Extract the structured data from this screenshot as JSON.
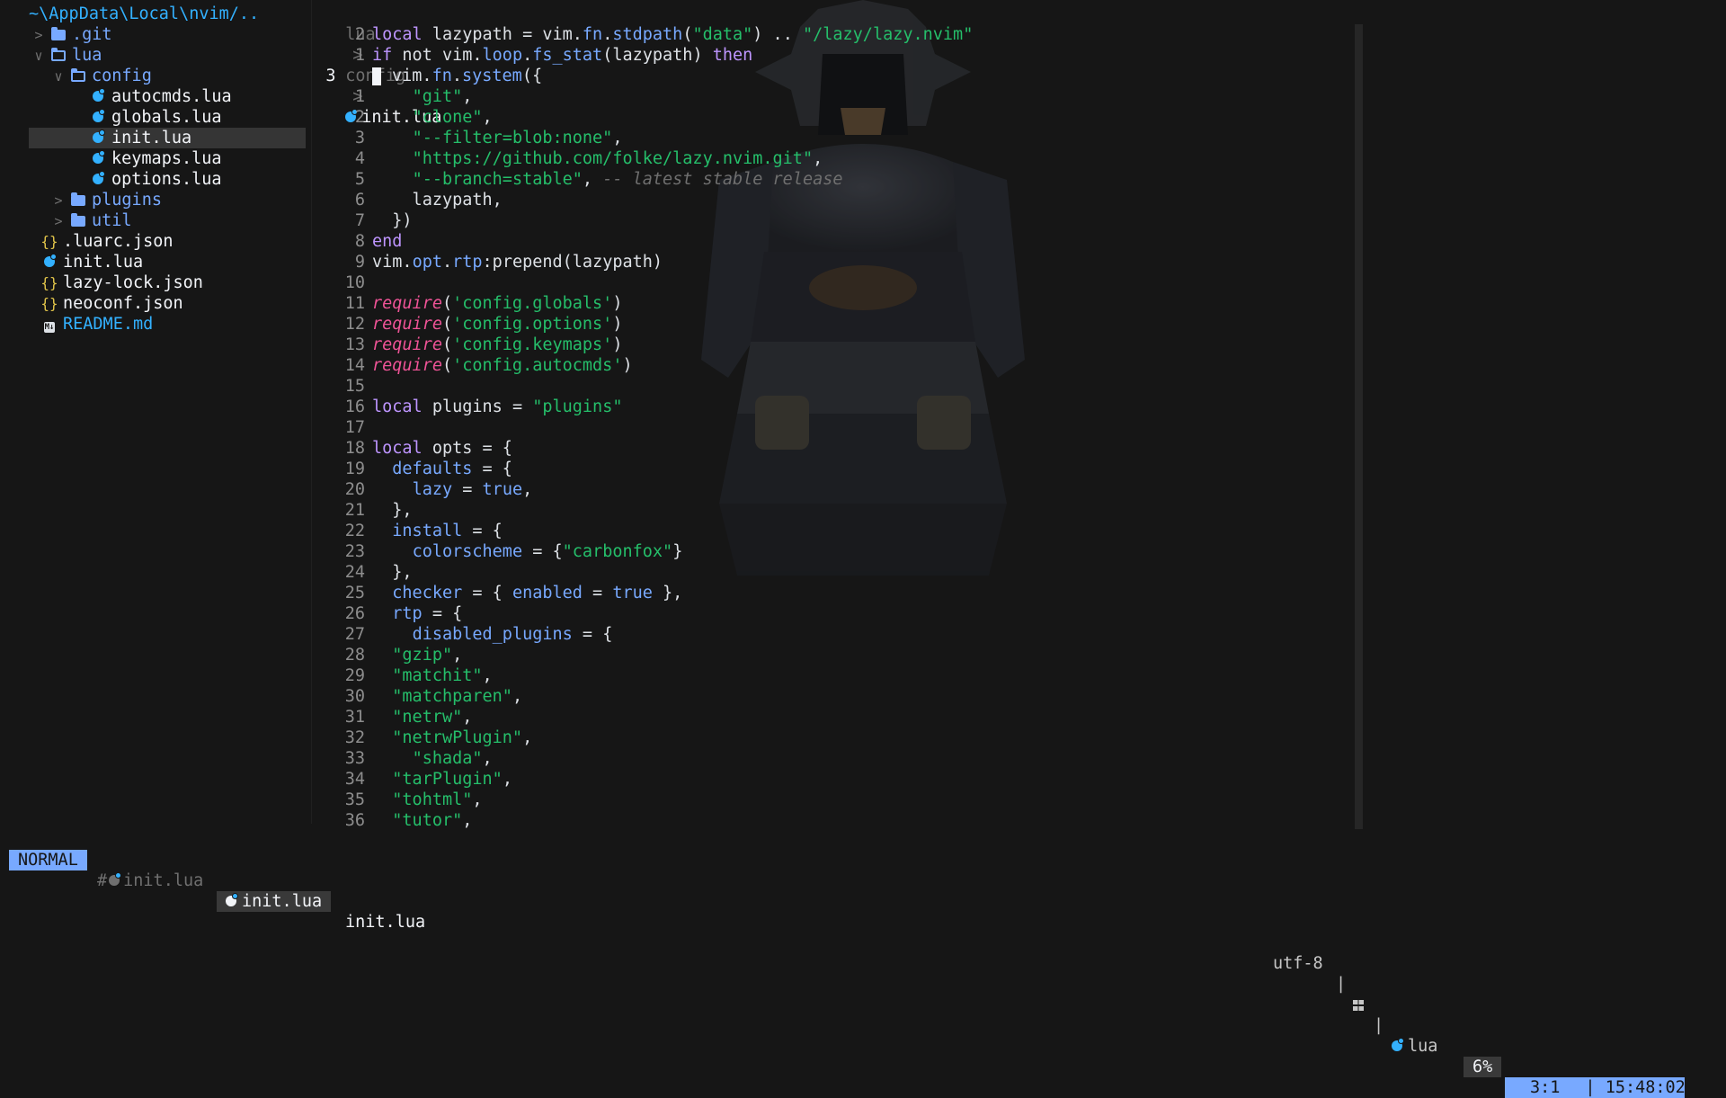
{
  "tree": {
    "root": "~\\AppData\\Local\\nvim/..",
    "items": [
      {
        "name": ".git",
        "kind": "dir",
        "depth": 0,
        "open": false,
        "icon": "folder-icon"
      },
      {
        "name": "lua",
        "kind": "dir",
        "depth": 0,
        "open": true,
        "icon": "folder-open-icon"
      },
      {
        "name": "config",
        "kind": "dir",
        "depth": 1,
        "open": true,
        "icon": "folder-open-icon"
      },
      {
        "name": "autocmds.lua",
        "kind": "lua",
        "depth": 2,
        "icon": "lua-icon"
      },
      {
        "name": "globals.lua",
        "kind": "lua",
        "depth": 2,
        "icon": "lua-icon"
      },
      {
        "name": "init.lua",
        "kind": "lua",
        "depth": 2,
        "icon": "lua-icon",
        "selected": true
      },
      {
        "name": "keymaps.lua",
        "kind": "lua",
        "depth": 2,
        "icon": "lua-icon"
      },
      {
        "name": "options.lua",
        "kind": "lua",
        "depth": 2,
        "icon": "lua-icon"
      },
      {
        "name": "plugins",
        "kind": "dir",
        "depth": 1,
        "open": false,
        "icon": "folder-icon"
      },
      {
        "name": "util",
        "kind": "dir",
        "depth": 1,
        "open": false,
        "icon": "folder-icon"
      },
      {
        "name": ".luarc.json",
        "kind": "json",
        "depth": 0,
        "icon": "json-icon"
      },
      {
        "name": "init.lua",
        "kind": "lua",
        "depth": 0,
        "icon": "lua-icon"
      },
      {
        "name": "lazy-lock.json",
        "kind": "json",
        "depth": 0,
        "icon": "json-icon"
      },
      {
        "name": "neoconf.json",
        "kind": "json",
        "depth": 0,
        "icon": "json-icon"
      },
      {
        "name": "README.md",
        "kind": "md",
        "depth": 0,
        "icon": "markdown-icon"
      }
    ]
  },
  "winbar": {
    "parts": [
      "lua",
      "config"
    ],
    "separator": ">",
    "file": "init.lua"
  },
  "code": [
    {
      "n": "2",
      "tokens": [
        [
          "kw",
          "local"
        ],
        [
          "src",
          " lazypath = vim."
        ],
        [
          "fld",
          "fn"
        ],
        [
          "src",
          "."
        ],
        [
          "fld",
          "stdpath"
        ],
        [
          "src",
          "("
        ],
        [
          "str",
          "\"data\""
        ],
        [
          "src",
          ") .. "
        ],
        [
          "str",
          "\"/lazy/lazy.nvim\""
        ]
      ]
    },
    {
      "n": "1",
      "tokens": [
        [
          "kw",
          "if"
        ],
        [
          "src",
          " not vim."
        ],
        [
          "fld",
          "loop"
        ],
        [
          "src",
          "."
        ],
        [
          "fld",
          "fs_stat"
        ],
        [
          "src",
          "(lazypath) "
        ],
        [
          "kw",
          "then"
        ]
      ]
    },
    {
      "n": "3",
      "cur": true,
      "tokens": [
        [
          "src",
          "vim."
        ],
        [
          "fld",
          "fn"
        ],
        [
          "src",
          "."
        ],
        [
          "fld",
          "system"
        ],
        [
          "src",
          "({"
        ]
      ]
    },
    {
      "n": "1",
      "tokens": [
        [
          "src",
          "    "
        ],
        [
          "str",
          "\"git\""
        ],
        [
          "src",
          ","
        ]
      ]
    },
    {
      "n": "2",
      "tokens": [
        [
          "src",
          "    "
        ],
        [
          "str",
          "\"clone\""
        ],
        [
          "src",
          ","
        ]
      ]
    },
    {
      "n": "3",
      "tokens": [
        [
          "src",
          "    "
        ],
        [
          "str",
          "\"--filter=blob:none\""
        ],
        [
          "src",
          ","
        ]
      ]
    },
    {
      "n": "4",
      "tokens": [
        [
          "src",
          "    "
        ],
        [
          "str",
          "\"https://github.com/folke/lazy.nvim.git\""
        ],
        [
          "src",
          ","
        ]
      ]
    },
    {
      "n": "5",
      "tokens": [
        [
          "src",
          "    "
        ],
        [
          "str",
          "\"--branch=stable\""
        ],
        [
          "src",
          ", "
        ],
        [
          "cmt",
          "-- latest stable release"
        ]
      ]
    },
    {
      "n": "6",
      "tokens": [
        [
          "src",
          "    lazypath,"
        ]
      ]
    },
    {
      "n": "7",
      "tokens": [
        [
          "src",
          "  })"
        ]
      ]
    },
    {
      "n": "8",
      "tokens": [
        [
          "kw",
          "end"
        ]
      ]
    },
    {
      "n": "9",
      "tokens": [
        [
          "src",
          "vim."
        ],
        [
          "fld",
          "opt"
        ],
        [
          "src",
          "."
        ],
        [
          "fld",
          "rtp"
        ],
        [
          "src",
          ":prepend(lazypath)"
        ]
      ]
    },
    {
      "n": "10",
      "tokens": []
    },
    {
      "n": "11",
      "tokens": [
        [
          "req",
          "require"
        ],
        [
          "src",
          "("
        ],
        [
          "str",
          "'config.globals'"
        ],
        [
          "src",
          ")"
        ]
      ]
    },
    {
      "n": "12",
      "tokens": [
        [
          "req",
          "require"
        ],
        [
          "src",
          "("
        ],
        [
          "str",
          "'config.options'"
        ],
        [
          "src",
          ")"
        ]
      ]
    },
    {
      "n": "13",
      "tokens": [
        [
          "req",
          "require"
        ],
        [
          "src",
          "("
        ],
        [
          "str",
          "'config.keymaps'"
        ],
        [
          "src",
          ")"
        ]
      ]
    },
    {
      "n": "14",
      "tokens": [
        [
          "req",
          "require"
        ],
        [
          "src",
          "("
        ],
        [
          "str",
          "'config.autocmds'"
        ],
        [
          "src",
          ")"
        ]
      ]
    },
    {
      "n": "15",
      "tokens": []
    },
    {
      "n": "16",
      "tokens": [
        [
          "kw",
          "local"
        ],
        [
          "src",
          " plugins = "
        ],
        [
          "str",
          "\"plugins\""
        ]
      ]
    },
    {
      "n": "17",
      "tokens": []
    },
    {
      "n": "18",
      "tokens": [
        [
          "kw",
          "local"
        ],
        [
          "src",
          " opts = {"
        ]
      ]
    },
    {
      "n": "19",
      "tokens": [
        [
          "src",
          "  "
        ],
        [
          "fld",
          "defaults"
        ],
        [
          "src",
          " = {"
        ]
      ]
    },
    {
      "n": "20",
      "tokens": [
        [
          "src",
          "    "
        ],
        [
          "fld",
          "lazy"
        ],
        [
          "src",
          " = "
        ],
        [
          "bool",
          "true"
        ],
        [
          "src",
          ","
        ]
      ]
    },
    {
      "n": "21",
      "tokens": [
        [
          "src",
          "  },"
        ]
      ]
    },
    {
      "n": "22",
      "tokens": [
        [
          "src",
          "  "
        ],
        [
          "fld",
          "install"
        ],
        [
          "src",
          " = {"
        ]
      ]
    },
    {
      "n": "23",
      "tokens": [
        [
          "src",
          "    "
        ],
        [
          "fld",
          "colorscheme"
        ],
        [
          "src",
          " = {"
        ],
        [
          "str",
          "\"carbonfox\""
        ],
        [
          "src",
          "}"
        ]
      ]
    },
    {
      "n": "24",
      "tokens": [
        [
          "src",
          "  },"
        ]
      ]
    },
    {
      "n": "25",
      "tokens": [
        [
          "src",
          "  "
        ],
        [
          "fld",
          "checker"
        ],
        [
          "src",
          " = { "
        ],
        [
          "fld",
          "enabled"
        ],
        [
          "src",
          " = "
        ],
        [
          "bool",
          "true"
        ],
        [
          "src",
          " },"
        ]
      ]
    },
    {
      "n": "26",
      "tokens": [
        [
          "src",
          "  "
        ],
        [
          "fld",
          "rtp"
        ],
        [
          "src",
          " = {"
        ]
      ]
    },
    {
      "n": "27",
      "tokens": [
        [
          "src",
          "    "
        ],
        [
          "fld",
          "disabled_plugins"
        ],
        [
          "src",
          " = {"
        ]
      ]
    },
    {
      "n": "28",
      "tokens": [
        [
          "src",
          "  "
        ],
        [
          "str",
          "\"gzip\""
        ],
        [
          "src",
          ","
        ]
      ]
    },
    {
      "n": "29",
      "tokens": [
        [
          "src",
          "  "
        ],
        [
          "str",
          "\"matchit\""
        ],
        [
          "src",
          ","
        ]
      ]
    },
    {
      "n": "30",
      "tokens": [
        [
          "src",
          "  "
        ],
        [
          "str",
          "\"matchparen\""
        ],
        [
          "src",
          ","
        ]
      ]
    },
    {
      "n": "31",
      "tokens": [
        [
          "src",
          "  "
        ],
        [
          "str",
          "\"netrw\""
        ],
        [
          "src",
          ","
        ]
      ]
    },
    {
      "n": "32",
      "tokens": [
        [
          "src",
          "  "
        ],
        [
          "str",
          "\"netrwPlugin\""
        ],
        [
          "src",
          ","
        ]
      ]
    },
    {
      "n": "33",
      "tokens": [
        [
          "src",
          "    "
        ],
        [
          "str",
          "\"shada\""
        ],
        [
          "src",
          ","
        ]
      ]
    },
    {
      "n": "34",
      "tokens": [
        [
          "src",
          "  "
        ],
        [
          "str",
          "\"tarPlugin\""
        ],
        [
          "src",
          ","
        ]
      ]
    },
    {
      "n": "35",
      "tokens": [
        [
          "src",
          "  "
        ],
        [
          "str",
          "\"tohtml\""
        ],
        [
          "src",
          ","
        ]
      ]
    },
    {
      "n": "36",
      "tokens": [
        [
          "src",
          "  "
        ],
        [
          "str",
          "\"tutor\""
        ],
        [
          "src",
          ","
        ]
      ]
    }
  ],
  "statusline": {
    "mode": "NORMAL",
    "buffers": [
      {
        "label": "init.lua",
        "prefix": "#",
        "state": "alternate"
      },
      {
        "label": "init.lua",
        "state": "current"
      }
    ],
    "filename": "init.lua",
    "encoding": "utf-8",
    "sep": "|",
    "os_icon": "windows-icon",
    "filetype": "lua",
    "percent": "6%",
    "position": "3:1",
    "time": "| 15:48:02"
  },
  "colors": {
    "background": "#161616",
    "accent": "#78a9ff",
    "string": "#25be6a",
    "keyword": "#be95ff",
    "require": "#ee5396",
    "lua_icon": "#33b1ff",
    "json_icon": "#e2c54a"
  }
}
